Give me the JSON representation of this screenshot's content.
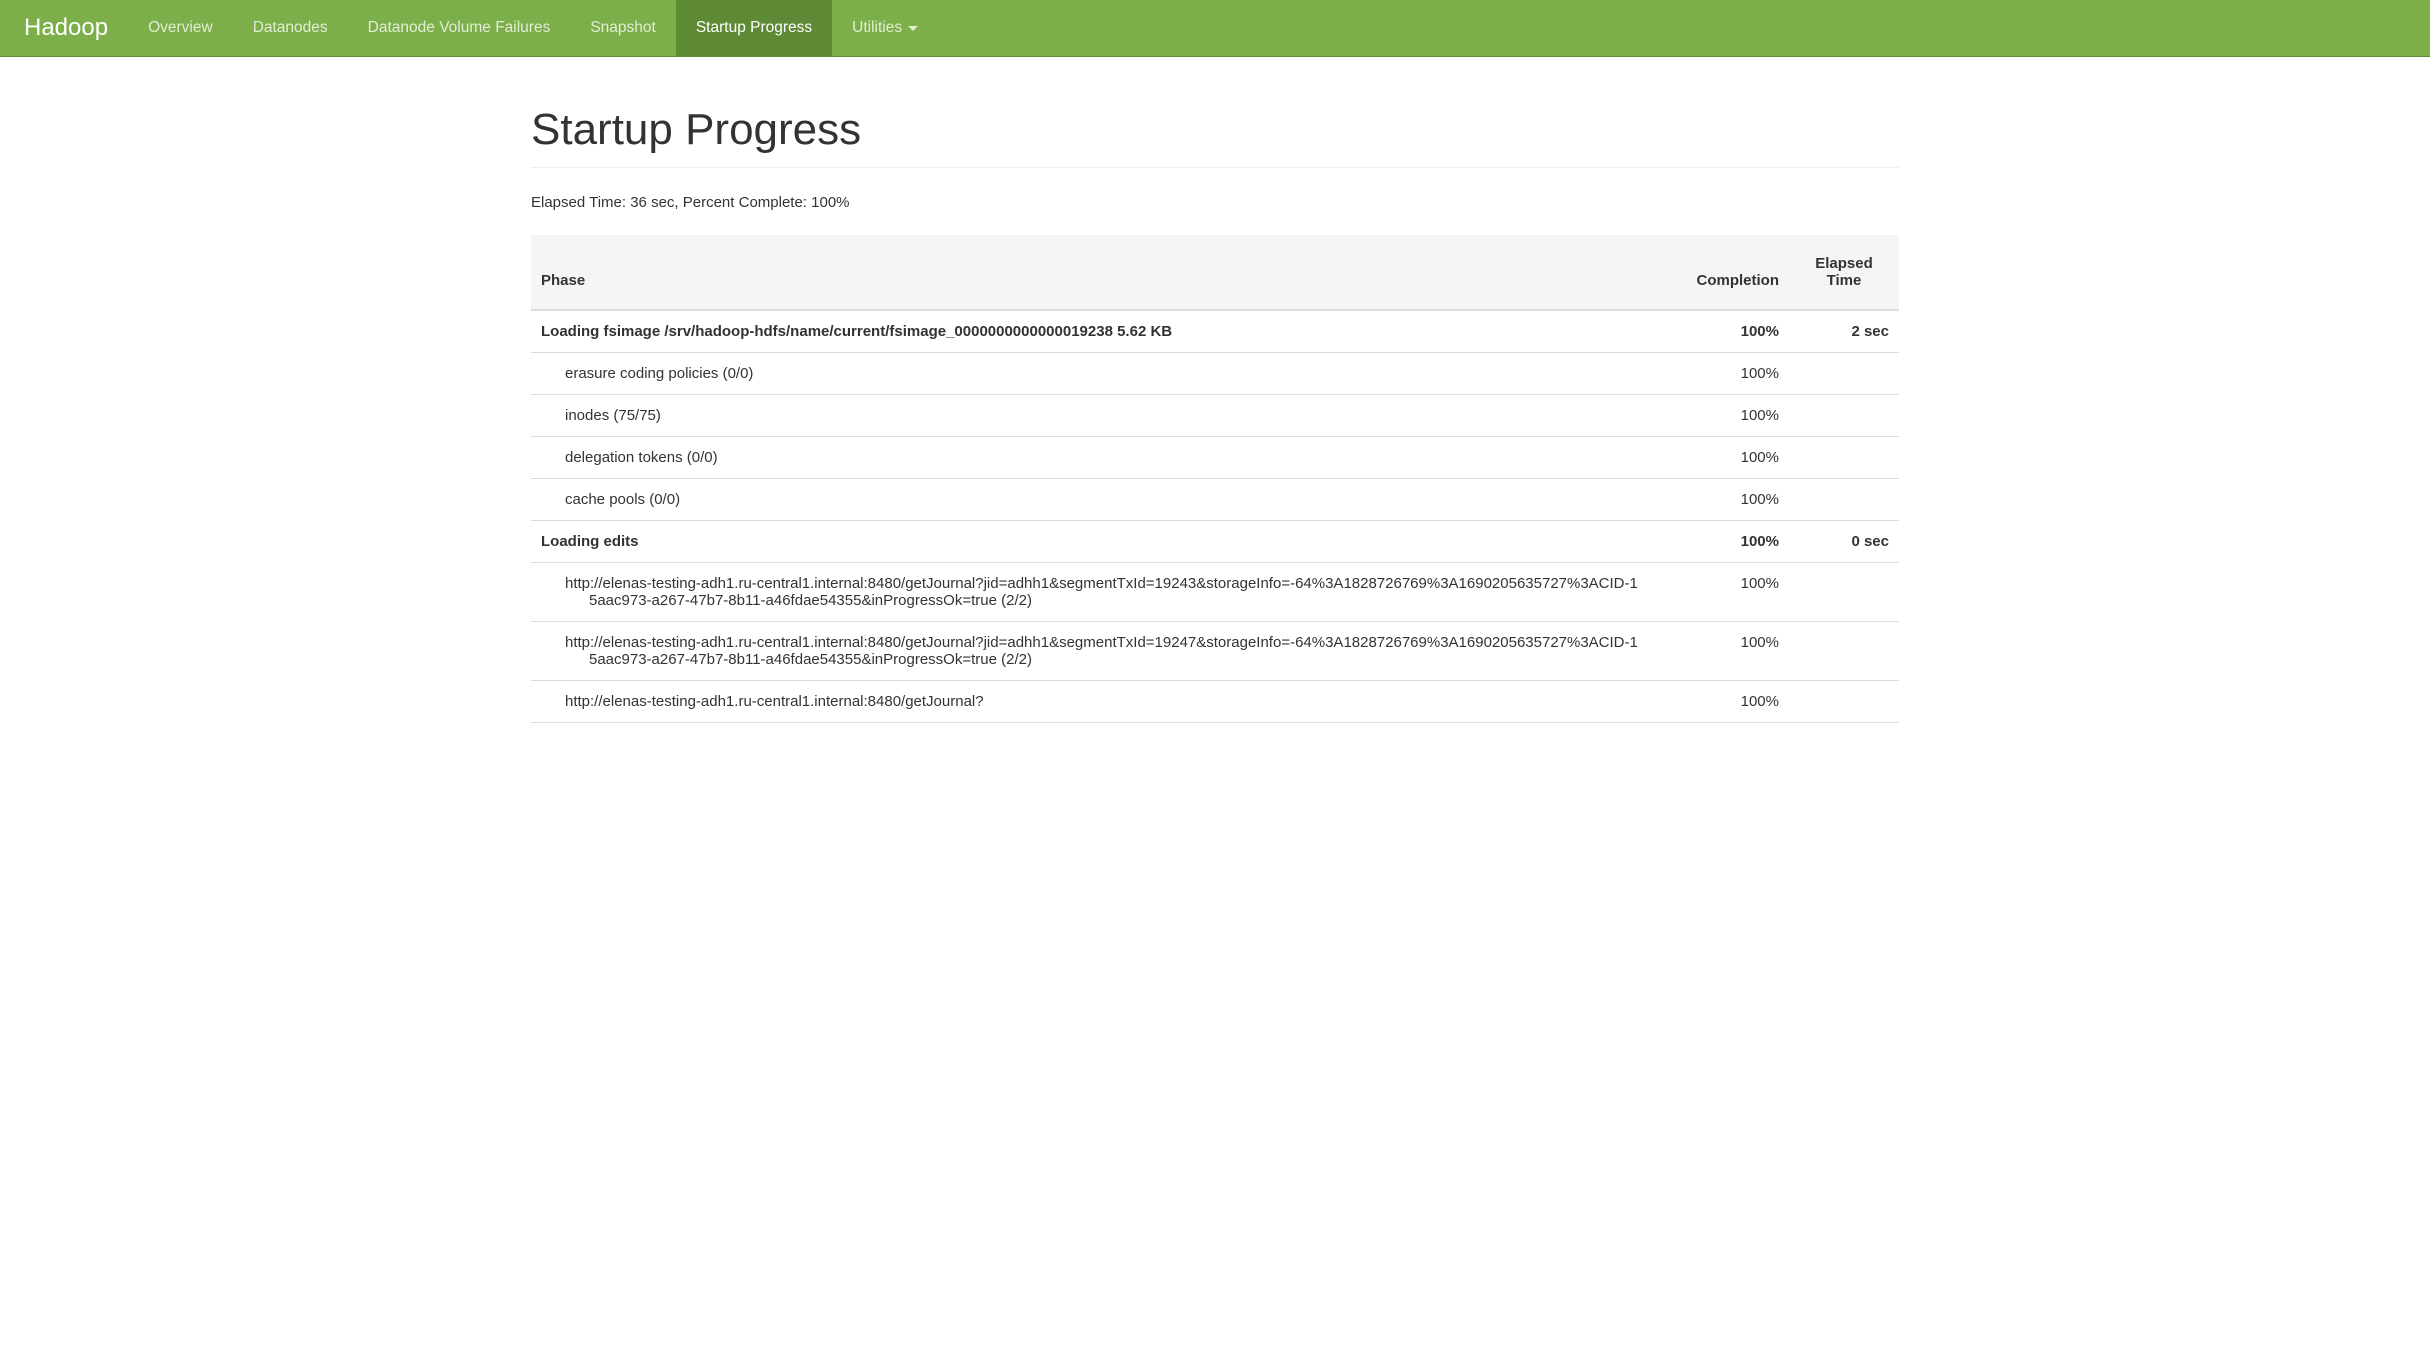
{
  "navbar": {
    "brand": "Hadoop",
    "items": [
      {
        "label": "Overview",
        "active": false
      },
      {
        "label": "Datanodes",
        "active": false
      },
      {
        "label": "Datanode Volume Failures",
        "active": false
      },
      {
        "label": "Snapshot",
        "active": false
      },
      {
        "label": "Startup Progress",
        "active": true
      },
      {
        "label": "Utilities",
        "active": false,
        "dropdown": true
      }
    ]
  },
  "page": {
    "title": "Startup Progress",
    "status": "Elapsed Time: 36 sec, Percent Complete: 100%"
  },
  "table": {
    "headers": {
      "phase": "Phase",
      "completion": "Completion",
      "elapsed": "Elapsed Time"
    },
    "rows": [
      {
        "type": "phase",
        "phase": "Loading fsimage /srv/hadoop-hdfs/name/current/fsimage_0000000000000019238 5.62 KB",
        "completion": "100%",
        "elapsed": "2 sec"
      },
      {
        "type": "step",
        "phase": "erasure coding policies (0/0)",
        "completion": "100%",
        "elapsed": ""
      },
      {
        "type": "step",
        "phase": "inodes (75/75)",
        "completion": "100%",
        "elapsed": ""
      },
      {
        "type": "step",
        "phase": "delegation tokens (0/0)",
        "completion": "100%",
        "elapsed": ""
      },
      {
        "type": "step",
        "phase": "cache pools (0/0)",
        "completion": "100%",
        "elapsed": ""
      },
      {
        "type": "phase",
        "phase": "Loading edits",
        "completion": "100%",
        "elapsed": "0 sec"
      },
      {
        "type": "step",
        "phase": "http://elenas-testing-adh1.ru-central1.internal:8480/getJournal?jid=adhh1&segmentTxId=19243&storageInfo=-64%3A1828726769%3A1690205635727%3ACID-15aac973-a267-47b7-8b11-a46fdae54355&inProgressOk=true (2/2)",
        "completion": "100%",
        "elapsed": ""
      },
      {
        "type": "step",
        "phase": "http://elenas-testing-adh1.ru-central1.internal:8480/getJournal?jid=adhh1&segmentTxId=19247&storageInfo=-64%3A1828726769%3A1690205635727%3ACID-15aac973-a267-47b7-8b11-a46fdae54355&inProgressOk=true (2/2)",
        "completion": "100%",
        "elapsed": ""
      },
      {
        "type": "step",
        "phase": "http://elenas-testing-adh1.ru-central1.internal:8480/getJournal?",
        "completion": "100%",
        "elapsed": ""
      }
    ]
  }
}
